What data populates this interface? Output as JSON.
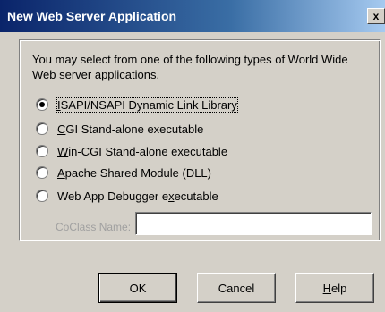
{
  "window": {
    "title": "New Web Server Application",
    "close_label": "x"
  },
  "description": "You may select from one of the following types of World Wide Web server applications.",
  "options": [
    {
      "pre": "",
      "mn": "I",
      "post": "SAPI/NSAPI Dynamic Link Library",
      "checked": true
    },
    {
      "pre": "",
      "mn": "C",
      "post": "GI Stand-alone executable",
      "checked": false
    },
    {
      "pre": "",
      "mn": "W",
      "post": "in-CGI Stand-alone executable",
      "checked": false
    },
    {
      "pre": "",
      "mn": "A",
      "post": "pache Shared Module (DLL)",
      "checked": false
    },
    {
      "pre": "Web App Debugger e",
      "mn": "x",
      "post": "ecutable",
      "checked": false
    }
  ],
  "coclass": {
    "label_pre": "CoClass ",
    "label_mn": "N",
    "label_post": "ame:",
    "value": ""
  },
  "buttons": {
    "ok": "OK",
    "cancel": "Cancel",
    "help_mn": "H",
    "help_rest": "elp"
  }
}
